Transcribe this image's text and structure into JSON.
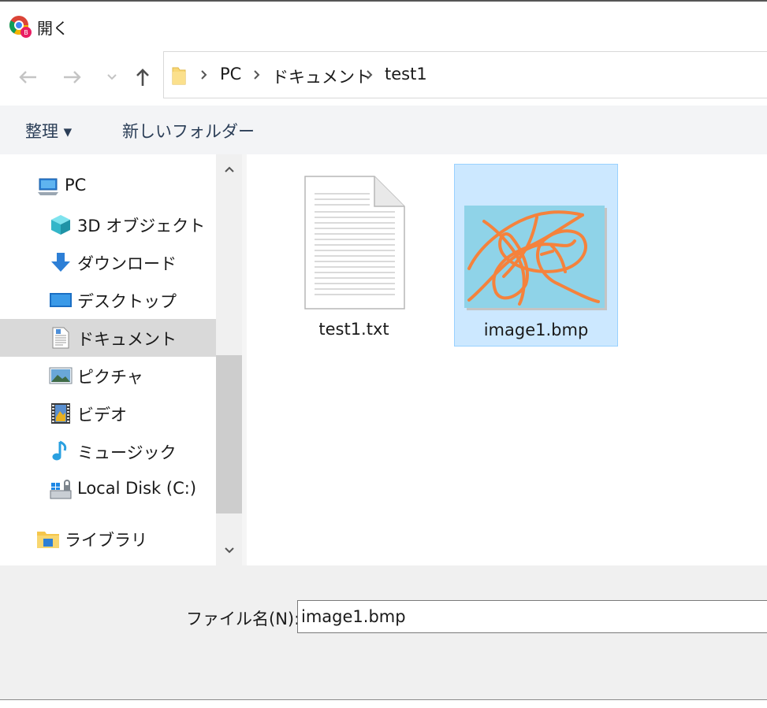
{
  "window": {
    "title": "開く"
  },
  "address": {
    "crumbs": [
      "PC",
      "ドキュメント",
      "test1"
    ]
  },
  "commands": {
    "organize": "整理 ▾",
    "new_folder": "新しいフォルダー"
  },
  "nav_pane": {
    "items": [
      {
        "label": "PC",
        "icon": "pc-icon"
      },
      {
        "label": "3D オブジェクト",
        "icon": "3d-objects-icon"
      },
      {
        "label": "ダウンロード",
        "icon": "download-icon"
      },
      {
        "label": "デスクトップ",
        "icon": "desktop-icon"
      },
      {
        "label": "ドキュメント",
        "icon": "documents-icon",
        "selected": true
      },
      {
        "label": "ピクチャ",
        "icon": "pictures-icon"
      },
      {
        "label": "ビデオ",
        "icon": "videos-icon"
      },
      {
        "label": "ミュージック",
        "icon": "music-icon"
      },
      {
        "label": "Local Disk (C:)",
        "icon": "local-disk-icon"
      },
      {
        "label": "ライブラリ",
        "icon": "libraries-icon"
      }
    ]
  },
  "files": [
    {
      "name": "test1.txt",
      "icon": "text-file-icon"
    },
    {
      "name": "image1.bmp",
      "icon": "bitmap-thumbnail",
      "selected": true
    }
  ],
  "filename": {
    "label": "ファイル名(N):",
    "value": "image1.bmp"
  },
  "colors": {
    "selection_fill": "#cce8ff",
    "selection_border": "#99d1ff",
    "thumbnail_bg": "#8fd3e8",
    "scribble": "#f5823c"
  }
}
